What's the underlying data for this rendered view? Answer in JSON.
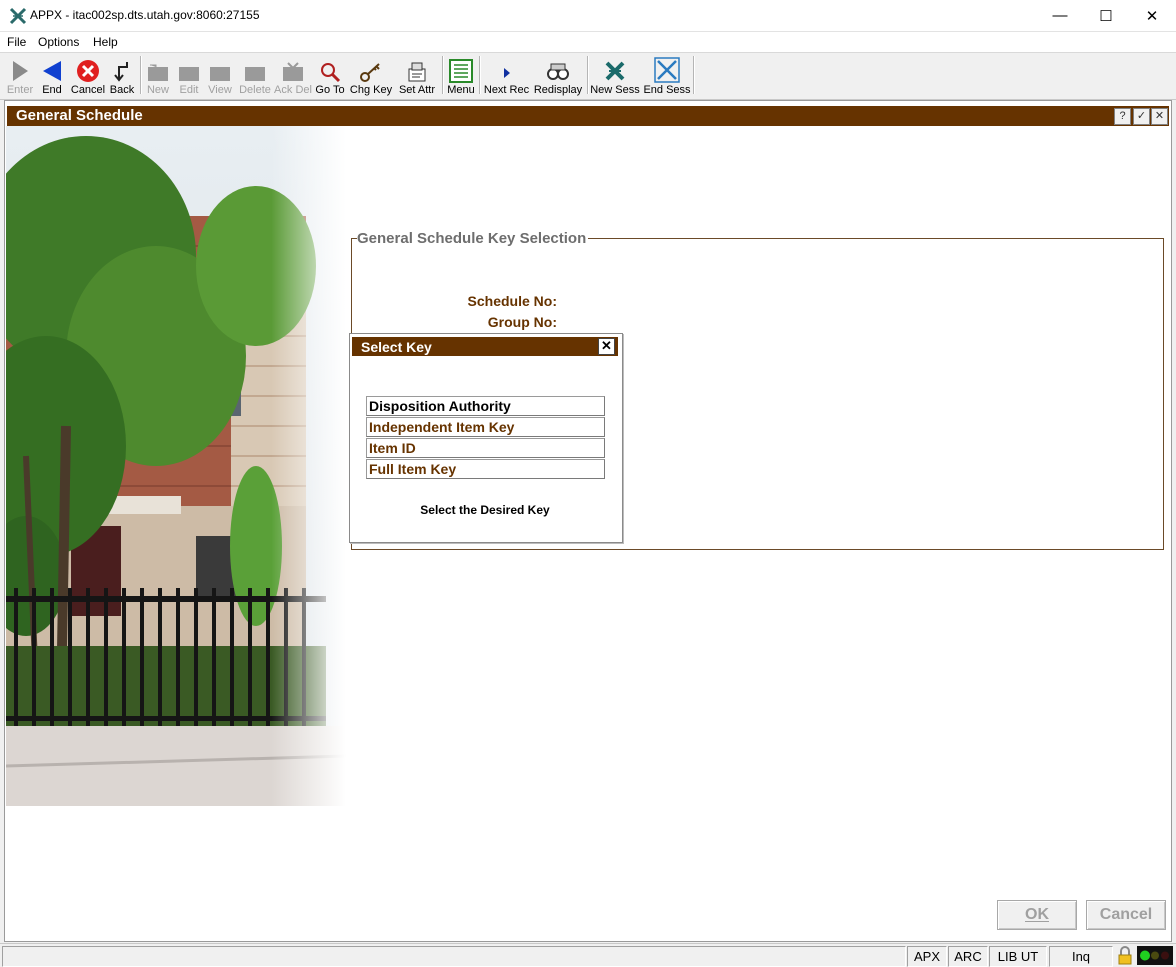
{
  "window": {
    "title": "APPX - itac002sp.dts.utah.gov:8060:27155",
    "minimize": "—",
    "maximize": "☐",
    "close": "✕"
  },
  "menu": [
    "File",
    "Options",
    "Help"
  ],
  "toolbar": {
    "enter": "Enter",
    "end": "End",
    "cancel": "Cancel",
    "back": "Back",
    "new": "New",
    "edit": "Edit",
    "view": "View",
    "delete": "Delete",
    "ack_del": "Ack Del",
    "goto": "Go To",
    "chg_key": "Chg Key",
    "set_attr": "Set Attr",
    "menu": "Menu",
    "next_rec": "Next Rec",
    "redisplay": "Redisplay",
    "new_sess": "New Sess",
    "end_sess": "End Sess"
  },
  "screen": {
    "title": "General Schedule",
    "help_btn": "?",
    "ok_btn": "✓",
    "close_btn": "✕"
  },
  "group": {
    "title": "General Schedule Key Selection",
    "schedule_label": "Schedule No:",
    "group_label": "Group No:"
  },
  "dialog": {
    "title": "Select Key",
    "close": "✕",
    "options": [
      "Disposition Authority",
      "Independent Item Key",
      "Item ID",
      "Full Item Key"
    ],
    "hint": "Select the Desired Key"
  },
  "buttons": {
    "ok": "OK",
    "cancel": "Cancel"
  },
  "status": {
    "apx": "APX",
    "arc": "ARC",
    "lib": "LIB UT",
    "mode": "Inq"
  },
  "colors": {
    "accent": "#663300",
    "selected_option": "#000000"
  }
}
